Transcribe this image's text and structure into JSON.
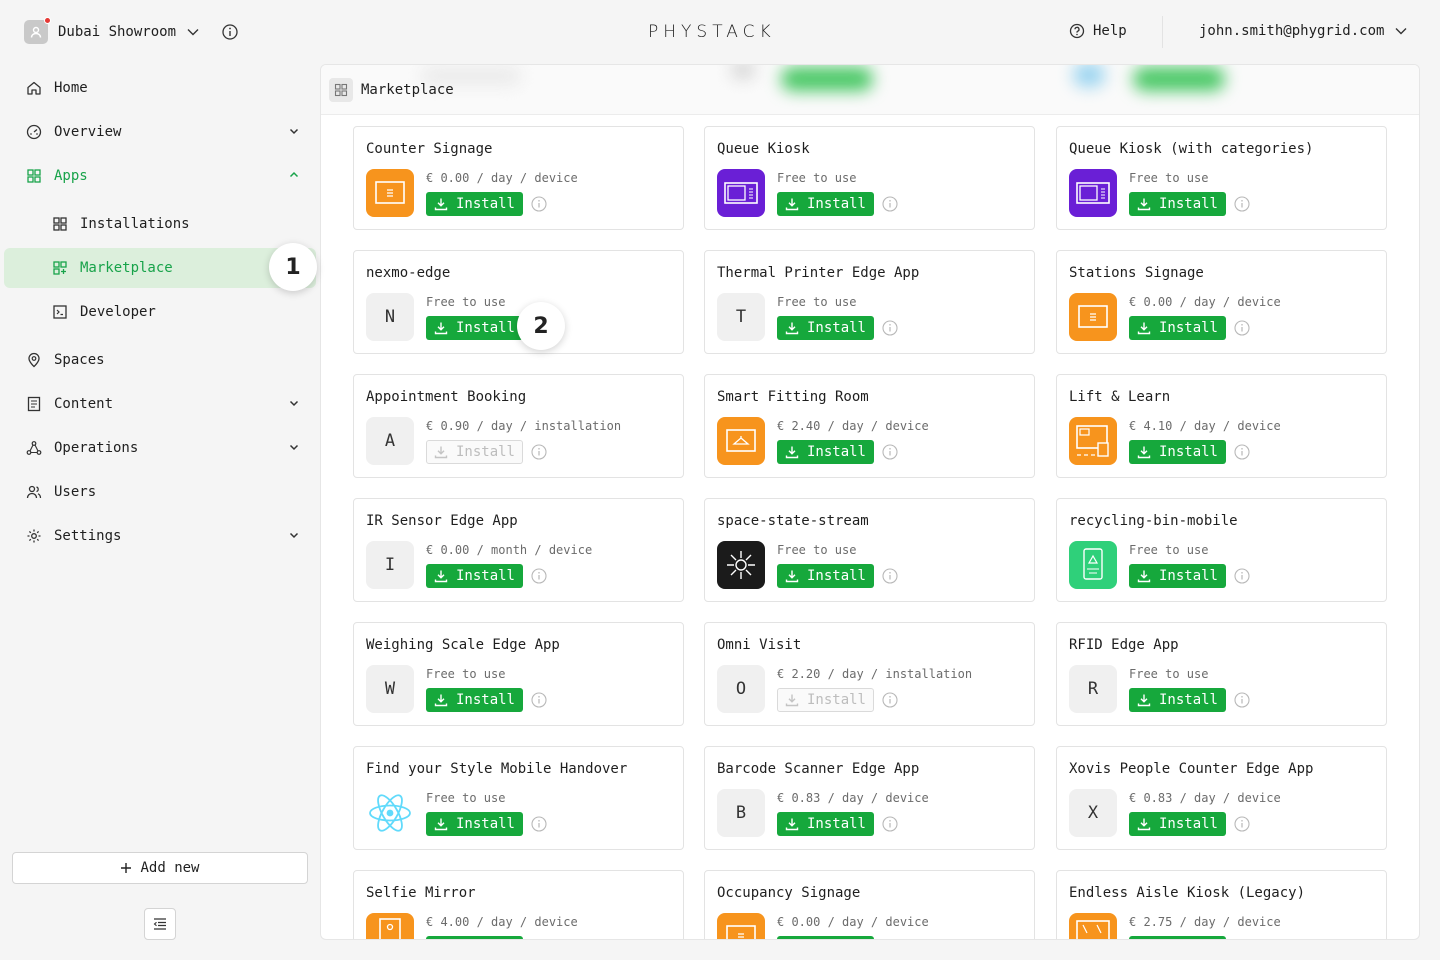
{
  "header": {
    "org_name": "Dubai Showroom",
    "brand": "PHYSTACK",
    "help_label": "Help",
    "user_email": "john.smith@phygrid.com"
  },
  "sidebar": {
    "items": [
      {
        "label": "Home",
        "icon": "home-icon"
      },
      {
        "label": "Overview",
        "icon": "gauge-icon",
        "expandable": true
      },
      {
        "label": "Apps",
        "icon": "grid-icon",
        "expanded": true
      },
      {
        "label": "Installations",
        "icon": "grid-icon"
      },
      {
        "label": "Marketplace",
        "icon": "grid-plus-icon",
        "active": true
      },
      {
        "label": "Developer",
        "icon": "terminal-icon"
      },
      {
        "label": "Spaces",
        "icon": "location-pin-icon"
      },
      {
        "label": "Content",
        "icon": "document-icon",
        "expandable": true
      },
      {
        "label": "Operations",
        "icon": "nodes-icon",
        "expandable": true
      },
      {
        "label": "Users",
        "icon": "users-icon"
      },
      {
        "label": "Settings",
        "icon": "gear-icon",
        "expandable": true
      }
    ],
    "add_new_label": "Add new"
  },
  "steps": {
    "one": "1",
    "two": "2"
  },
  "main": {
    "title": "Marketplace",
    "install_label": "Install",
    "cards": [
      {
        "title": "Counter Signage",
        "price": "€ 0.00 / day / device",
        "icon": "orange-screen"
      },
      {
        "title": "Queue Kiosk",
        "price": "Free to use",
        "icon": "purple-kiosk"
      },
      {
        "title": "Queue Kiosk (with categories)",
        "price": "Free to use",
        "icon": "purple-kiosk"
      },
      {
        "title": "nexmo-edge",
        "price": "Free to use",
        "letter": "N"
      },
      {
        "title": "Thermal Printer Edge App",
        "price": "Free to use",
        "letter": "T"
      },
      {
        "title": "Stations Signage",
        "price": "€ 0.00 / day / device",
        "icon": "orange-screen"
      },
      {
        "title": "Appointment Booking",
        "price": "€ 0.90 / day / installation",
        "letter": "A",
        "disabled": true
      },
      {
        "title": "Smart Fitting Room",
        "price": "€ 2.40 / day / device",
        "icon": "orange-hanger"
      },
      {
        "title": "Lift & Learn",
        "price": "€ 4.10 / day / device",
        "icon": "orange-lift"
      },
      {
        "title": "IR Sensor Edge App",
        "price": "€ 0.00 / month / device",
        "letter": "I"
      },
      {
        "title": "space-state-stream",
        "price": "Free to use",
        "icon": "dark-sun"
      },
      {
        "title": "recycling-bin-mobile",
        "price": "Free to use",
        "icon": "green-bin"
      },
      {
        "title": "Weighing Scale Edge App",
        "price": "Free to use",
        "letter": "W"
      },
      {
        "title": "Omni Visit",
        "price": "€ 2.20 / day / installation",
        "letter": "O",
        "disabled": true
      },
      {
        "title": "RFID Edge App",
        "price": "Free to use",
        "letter": "R"
      },
      {
        "title": "Find your Style Mobile Handover",
        "price": "Free to use",
        "icon": "react-atom"
      },
      {
        "title": "Barcode Scanner Edge App",
        "price": "€ 0.83 / day / device",
        "letter": "B"
      },
      {
        "title": "Xovis People Counter Edge App",
        "price": "€ 0.83 / day / device",
        "letter": "X"
      },
      {
        "title": "Selfie Mirror",
        "price": "€ 4.00 / day / device",
        "icon": "orange-mirror"
      },
      {
        "title": "Occupancy Signage",
        "price": "€ 0.00 / day / device",
        "icon": "orange-screen"
      },
      {
        "title": "Endless Aisle Kiosk (Legacy)",
        "price": "€ 2.75 / day / device",
        "icon": "orange-kiosk"
      }
    ]
  },
  "colors": {
    "accent": "#16a83c",
    "active_bg": "#dcefdc",
    "orange": "#f7941d",
    "purple": "#6a1fd6"
  }
}
